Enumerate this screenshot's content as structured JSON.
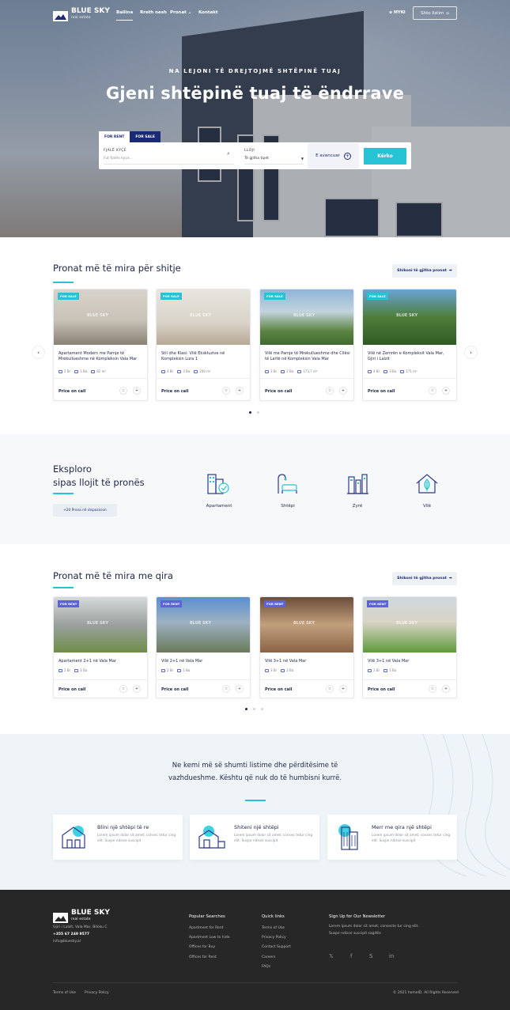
{
  "nav": {
    "brand": "BLUE SKY",
    "brand_sub": "real estate",
    "links": [
      "Ballina",
      "Rreth nesh",
      "Pronat",
      "Kontakt"
    ],
    "lang": "MYNI",
    "list_button": "Shto listim"
  },
  "hero": {
    "kicker": "NA LEJONI TË DREJTOJMË SHTËPINË TUAJ",
    "title": "Gjeni shtëpinë tuaj të ëndrrave",
    "tab_rent": "FOR RENT",
    "tab_sale": "FOR SALE",
    "keyword_label": "FJALË KYÇE",
    "keyword_placeholder": "Fut fjalën kyçe...",
    "type_label": "LLOJI",
    "type_value": "Të gjitha tipet",
    "advanced": "E avancuar",
    "search": "Kërko"
  },
  "sale": {
    "title": "Pronat më të mira për shitje",
    "view_all": "Shikoni të gjitha pronat",
    "cards": [
      {
        "badge": "FOR SALE",
        "title": "Apartament Modern me Pamje të Mrekullueshme në Kompleksin Vala Mar",
        "beds": "2 Br",
        "baths": "1 Ba",
        "area": "82 m²",
        "price": "Price on call"
      },
      {
        "badge": "FOR SALE",
        "title": "Stil dhe Klasi: Vilë Ekskluzive në Kompleksin Lura 1",
        "beds": "4 Br",
        "baths": "3 Ba",
        "area": "240 m²",
        "price": "Price on call"
      },
      {
        "badge": "FOR SALE",
        "title": "Vilë me Pamje të Mrekullueshme dhe Cilësi të Lartë në Kompleksin Vala Mar",
        "beds": "3 Br",
        "baths": "2 Ba",
        "area": "173,7 m²",
        "price": "Price on call"
      },
      {
        "badge": "FOR SALE",
        "title": "Vilë në Zemrën e Kompleksit Vala Mar, Gjiri i Lalzit",
        "beds": "4 Br",
        "baths": "3 Ba",
        "area": "171 m²",
        "price": "Price on call"
      }
    ]
  },
  "explore": {
    "title_line1": "Eksploro",
    "title_line2": "sipas llojit të pronës",
    "button": "+20 Prona në dispozicion",
    "types": [
      "Apartament",
      "Shtëpi",
      "Zyrë",
      "Vilë"
    ]
  },
  "rent": {
    "title": "Pronat më të mira me qira",
    "view_all": "Shikoni të gjitha pronat",
    "cards": [
      {
        "badge": "FOR RENT",
        "title": "Apartament 2+1 në Vala Mar",
        "beds": "2 Br",
        "baths": "1 Ba",
        "price": "Price on call"
      },
      {
        "badge": "FOR RENT",
        "title": "Vilë 2+1 në Vala Mar",
        "beds": "2 Br",
        "baths": "1 Ba",
        "price": "Price on call"
      },
      {
        "badge": "FOR RENT",
        "title": "Vilë 3+1 në Vala Mar",
        "beds": "3 Br",
        "baths": "2 Ba",
        "price": "Price on call"
      },
      {
        "badge": "FOR RENT",
        "title": "Vilë 3+1 në Vala Mar",
        "beds": "3 Br",
        "baths": "1 Ba",
        "price": "Price on call"
      }
    ]
  },
  "banner": {
    "text": "Ne kemi më së shumti listime dhe përditësime të vazhdueshme. Kështu që nuk do të humbisni kurrë.",
    "features": [
      {
        "title": "Blini një shtëpi të re",
        "text": "Lorem ipsum dolor sit amet, consec tetur cing elit. Suspe ndisse suscipit"
      },
      {
        "title": "Shiteni një shtëpi",
        "text": "Lorem ipsum dolor sit amet, consec tetur cing elit. Suspe ndisse suscipit"
      },
      {
        "title": "Merr me qira një shtëpi",
        "text": "Lorem ipsum dolor sit amet, consec tetur cing elit. Suspe ndisse suscipit"
      }
    ]
  },
  "footer": {
    "brand": "BLUE SKY",
    "brand_sub": "real estate",
    "address": "Gjiri i Lalzit, Vala Mar, Blloku C",
    "phone": "+355 67 249 9577",
    "email": "info@bluesky.al",
    "popular_title": "Popular Searches",
    "popular": [
      "Apartment for Rent",
      "Apartment Low to hide",
      "Offices for Buy",
      "Offices for Rent"
    ],
    "quick_title": "Quick links",
    "quick": [
      "Terms of Use",
      "Privacy Policy",
      "Contact Support",
      "Careers",
      "FAQs"
    ],
    "newsletter_title": "Sign Up for Our Newsletter",
    "newsletter_text": "Lorem ipsum dolor sit amet, consecte tur cing elit. Suspe ndisse suscipit sagittis",
    "bottom_links": [
      "Terms of Use",
      "Privacy Policy"
    ],
    "copyright": "© 2021 homeID. All Rights Reserved"
  },
  "colors": {
    "accent": "#27c2d3",
    "navy": "#1b2a74",
    "badge_rent": "#5c63d8",
    "footer_bg": "#272727"
  }
}
